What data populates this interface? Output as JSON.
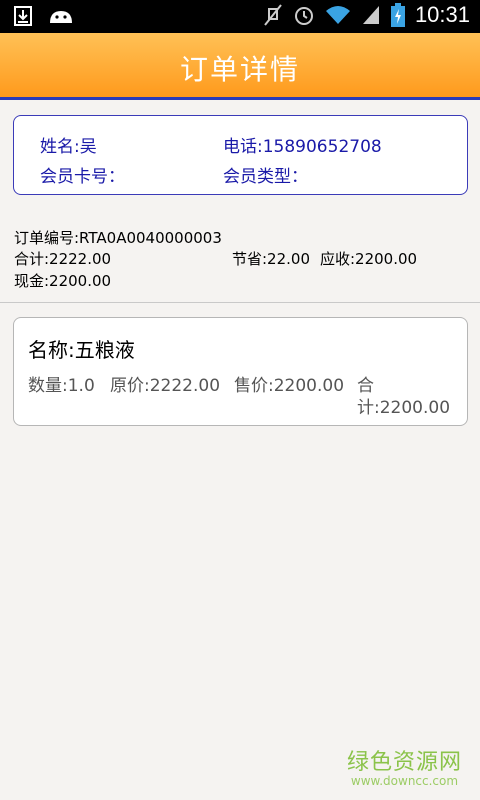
{
  "status_bar": {
    "time": "10:31",
    "icons": [
      "download-icon",
      "android-icon",
      "mute-icon",
      "alarm-icon",
      "wifi-icon",
      "signal-icon",
      "battery-icon"
    ]
  },
  "title_bar": {
    "title": "订单详情"
  },
  "member": {
    "name": "姓名:吴",
    "phone": "电话:15890652708",
    "card_no": "会员卡号：",
    "member_type": "会员类型："
  },
  "order": {
    "order_no": "订单编号:RTA0A0040000003",
    "total": "合计:2222.00",
    "saved": "节省:22.00",
    "receivable": "应收:2200.00",
    "cash": "现金:2200.00"
  },
  "items": [
    {
      "name": "名称:五粮液",
      "quantity": "数量:1.0",
      "original_price": "原价:2222.00",
      "sale_price": "售价:2200.00",
      "subtotal_line1": "合",
      "subtotal_line2": "计:2200.00"
    }
  ],
  "watermark": {
    "title": "绿色资源网",
    "url": "www.downcc.com"
  },
  "colors": {
    "title_bar": "#ff9a1c",
    "accent_blue": "#1a1aa8",
    "background": "#f5f3f1"
  }
}
